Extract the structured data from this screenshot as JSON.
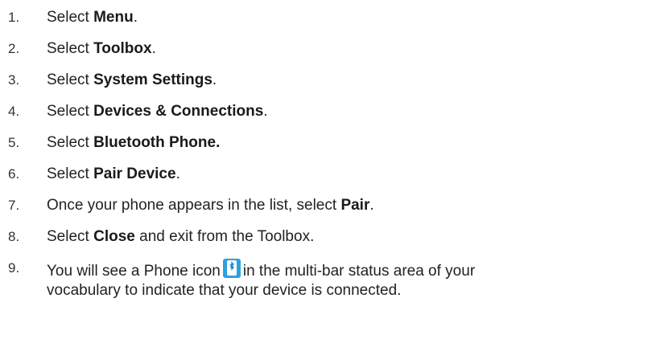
{
  "steps": [
    {
      "num": "1.",
      "pre": "Select ",
      "bold": "Menu",
      "post": "."
    },
    {
      "num": "2.",
      "pre": "Select ",
      "bold": "Toolbox",
      "post": "."
    },
    {
      "num": "3.",
      "pre": "Select ",
      "bold": "System Settings",
      "post": "."
    },
    {
      "num": "4.",
      "pre": "Select ",
      "bold": "Devices & Connections",
      "post": "."
    },
    {
      "num": "5.",
      "pre": "Select ",
      "bold": "Bluetooth Phone.",
      "post": ""
    },
    {
      "num": "6.",
      "pre": "Select ",
      "bold": "Pair Device",
      "post": "."
    },
    {
      "num": "7.",
      "pre": "Once your phone appears in the list, select ",
      "bold": "Pair",
      "post": "."
    },
    {
      "num": "8.",
      "pre": "Select ",
      "bold": "Close",
      "post": " and exit from the Toolbox."
    },
    {
      "num": "9.",
      "pre": "You will see a Phone icon",
      "post": "in the multi-bar status area of your",
      "line2": "vocabulary to indicate that your device is connected."
    }
  ],
  "icon": "bluetooth-phone-icon",
  "colors": {
    "icon_bg": "#29a3e0",
    "icon_inner": "#ffffff",
    "bt_symbol": "#1e88c8"
  }
}
